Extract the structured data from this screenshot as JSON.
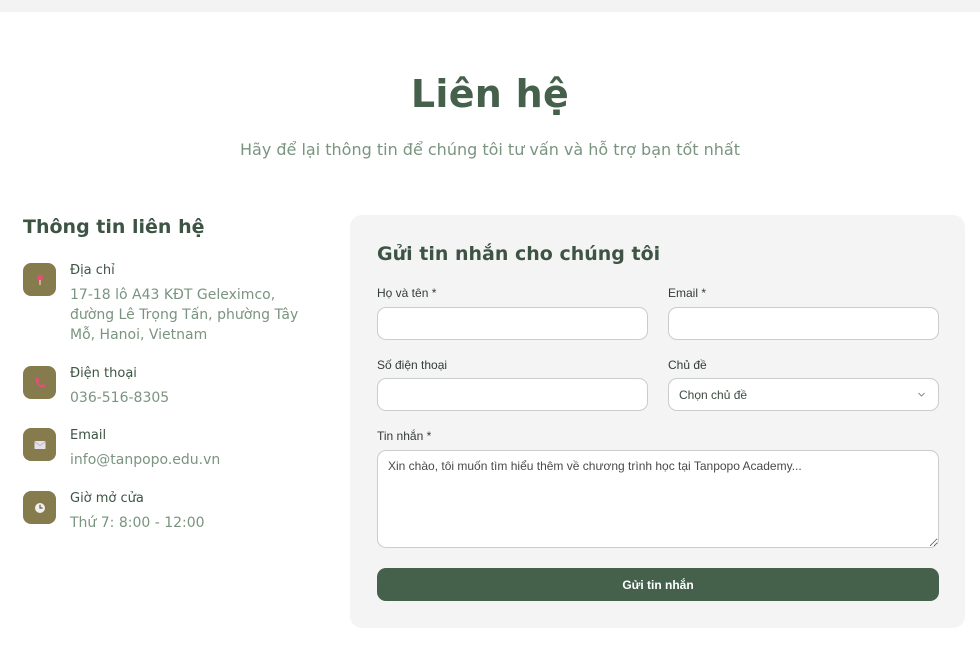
{
  "header": {
    "title": "Liên hệ",
    "subtitle": "Hãy để lại thông tin để chúng tôi tư vấn và hỗ trợ bạn tốt nhất"
  },
  "contact_info": {
    "heading": "Thông tin liên hệ",
    "items": [
      {
        "icon": "map-pin-icon",
        "label": "Địa chỉ",
        "value": "17-18 lô A43 KĐT Geleximco, đường Lê Trọng Tấn, phường Tây Mỗ, Hanoi, Vietnam"
      },
      {
        "icon": "phone-icon",
        "label": "Điện thoại",
        "value": "036-516-8305"
      },
      {
        "icon": "envelope-icon",
        "label": "Email",
        "value": "info@tanpopo.edu.vn"
      },
      {
        "icon": "clock-icon",
        "label": "Giờ mở cửa",
        "value": "Thứ 7: 8:00 - 12:00"
      }
    ]
  },
  "form": {
    "title": "Gửi tin nhắn cho chúng tôi",
    "name_label": "Họ và tên *",
    "name_value": "",
    "email_label": "Email *",
    "email_value": "",
    "phone_label": "Số điện thoại",
    "phone_value": "",
    "topic_label": "Chủ đề",
    "topic_selected": "Chọn chủ đề",
    "message_label": "Tin nhắn *",
    "message_placeholder": "Xin chào, tôi muốn tìm hiểu thêm về chương trình học tại Tanpopo Academy...",
    "submit_label": "Gửi tin nhắn"
  },
  "colors": {
    "primary": "#45604b",
    "accent_icon_bg": "#857b4d",
    "muted_text": "#7a9480",
    "panel_bg": "#f4f4f4"
  }
}
